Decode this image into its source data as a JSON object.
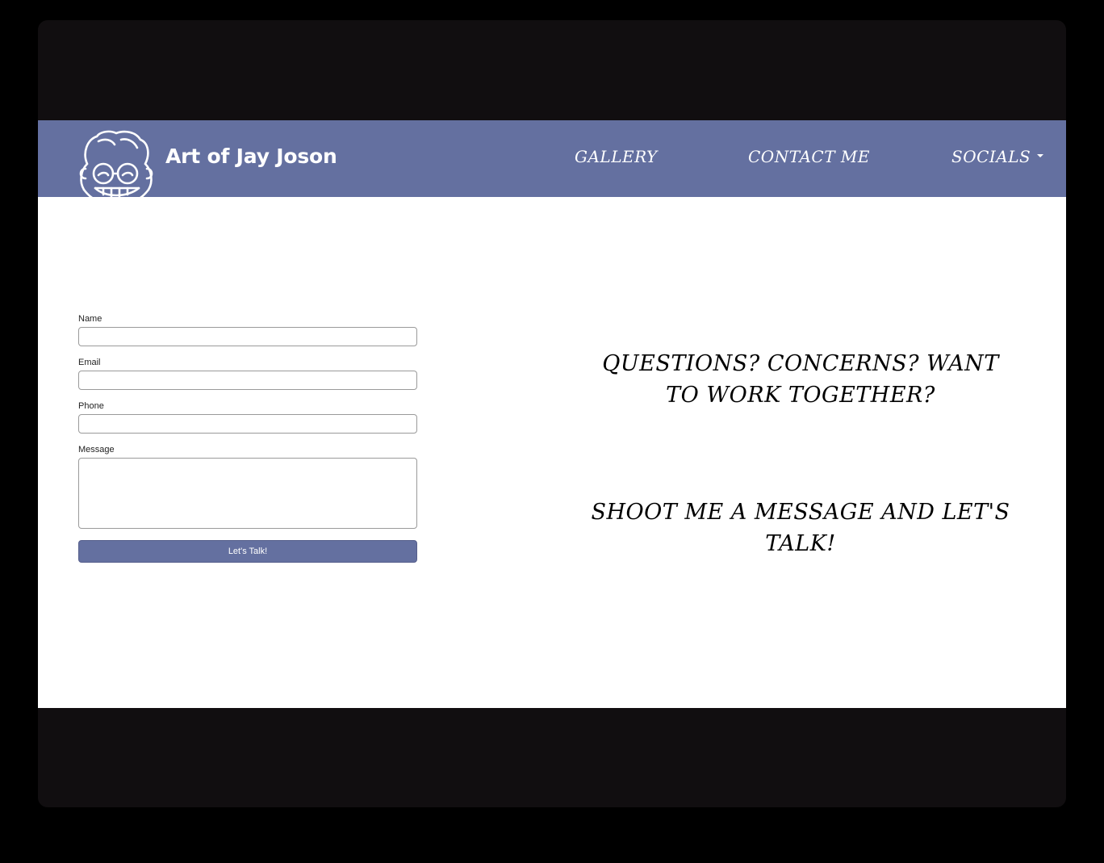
{
  "navbar": {
    "brand": "Art of Jay Joson",
    "logo_icon": "caricature-logo-icon",
    "links": [
      {
        "label": "Gallery"
      },
      {
        "label": "Contact Me"
      },
      {
        "label": "Socials",
        "has_dropdown": true
      }
    ]
  },
  "form": {
    "name_label": "Name",
    "name_value": "",
    "email_label": "Email",
    "email_value": "",
    "phone_label": "Phone",
    "phone_value": "",
    "message_label": "Message",
    "message_value": "",
    "submit_label": "Let's Talk!"
  },
  "tagline": {
    "line1": "Questions? Concerns? Want to work together?",
    "line2": "Shoot me a message and let's talk!"
  },
  "colors": {
    "accent": "#6470a0",
    "frame": "#110e10",
    "background": "#000000",
    "text": "#000000"
  }
}
